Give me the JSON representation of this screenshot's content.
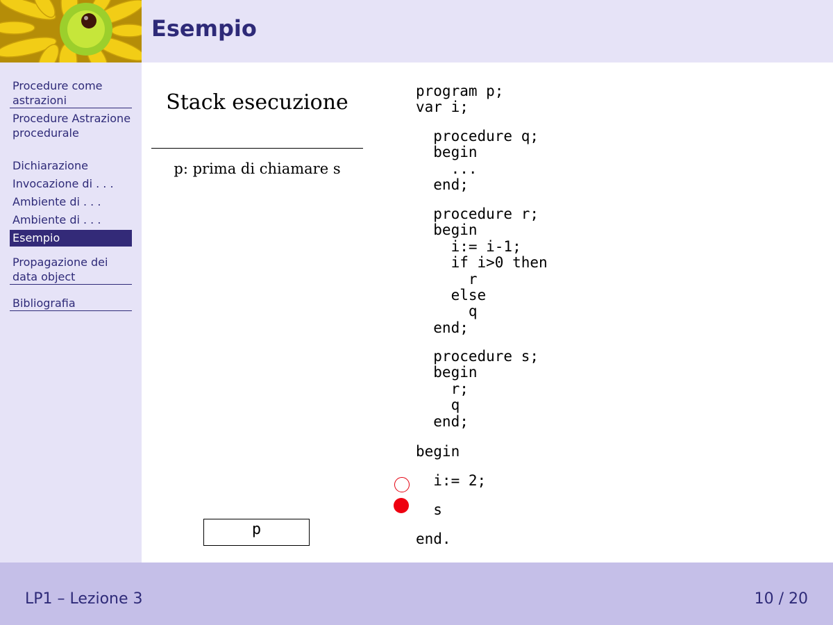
{
  "header": {
    "title": "Esempio"
  },
  "sidebar": {
    "items": [
      {
        "label": "Procedure come astrazioni"
      },
      {
        "label": "Procedure Astrazione procedurale"
      },
      {
        "label": "Dichiarazione"
      },
      {
        "label": "Invocazione di . . ."
      },
      {
        "label": "Ambiente di . . ."
      },
      {
        "label": "Ambiente di . . ."
      },
      {
        "label": "Esempio"
      },
      {
        "label": "Propagazione dei data object"
      },
      {
        "label": "Bibliografia"
      }
    ],
    "active_index": 6
  },
  "stack": {
    "title": "Stack esecuzione",
    "caption": "p: prima di chiamare s",
    "frames": [
      "p"
    ]
  },
  "code": {
    "header": "program p;\nvar i;",
    "proc_q": "  procedure q;\n  begin\n    ...\n  end;",
    "proc_r": "  procedure r;\n  begin\n    i:= i-1;\n    if i>0 then\n      r\n    else\n      q\n  end;",
    "proc_s": "  procedure s;\n  begin\n    r;\n    q\n  end;",
    "begin": "begin",
    "stmt1": "  i:= 2;",
    "stmt2": "  s",
    "end": "end."
  },
  "execution_markers": {
    "executed_line": "i:= 2;",
    "current_line": "s"
  },
  "colors": {
    "header_bg": "#e6e3f7",
    "title": "#2e2a78",
    "footer_bg": "#c5bfe8",
    "active_nav_bg": "#332a78",
    "marker": "#ee0010"
  },
  "footer": {
    "left": "LP1 – Lezione 3",
    "page": "10 / 20"
  }
}
